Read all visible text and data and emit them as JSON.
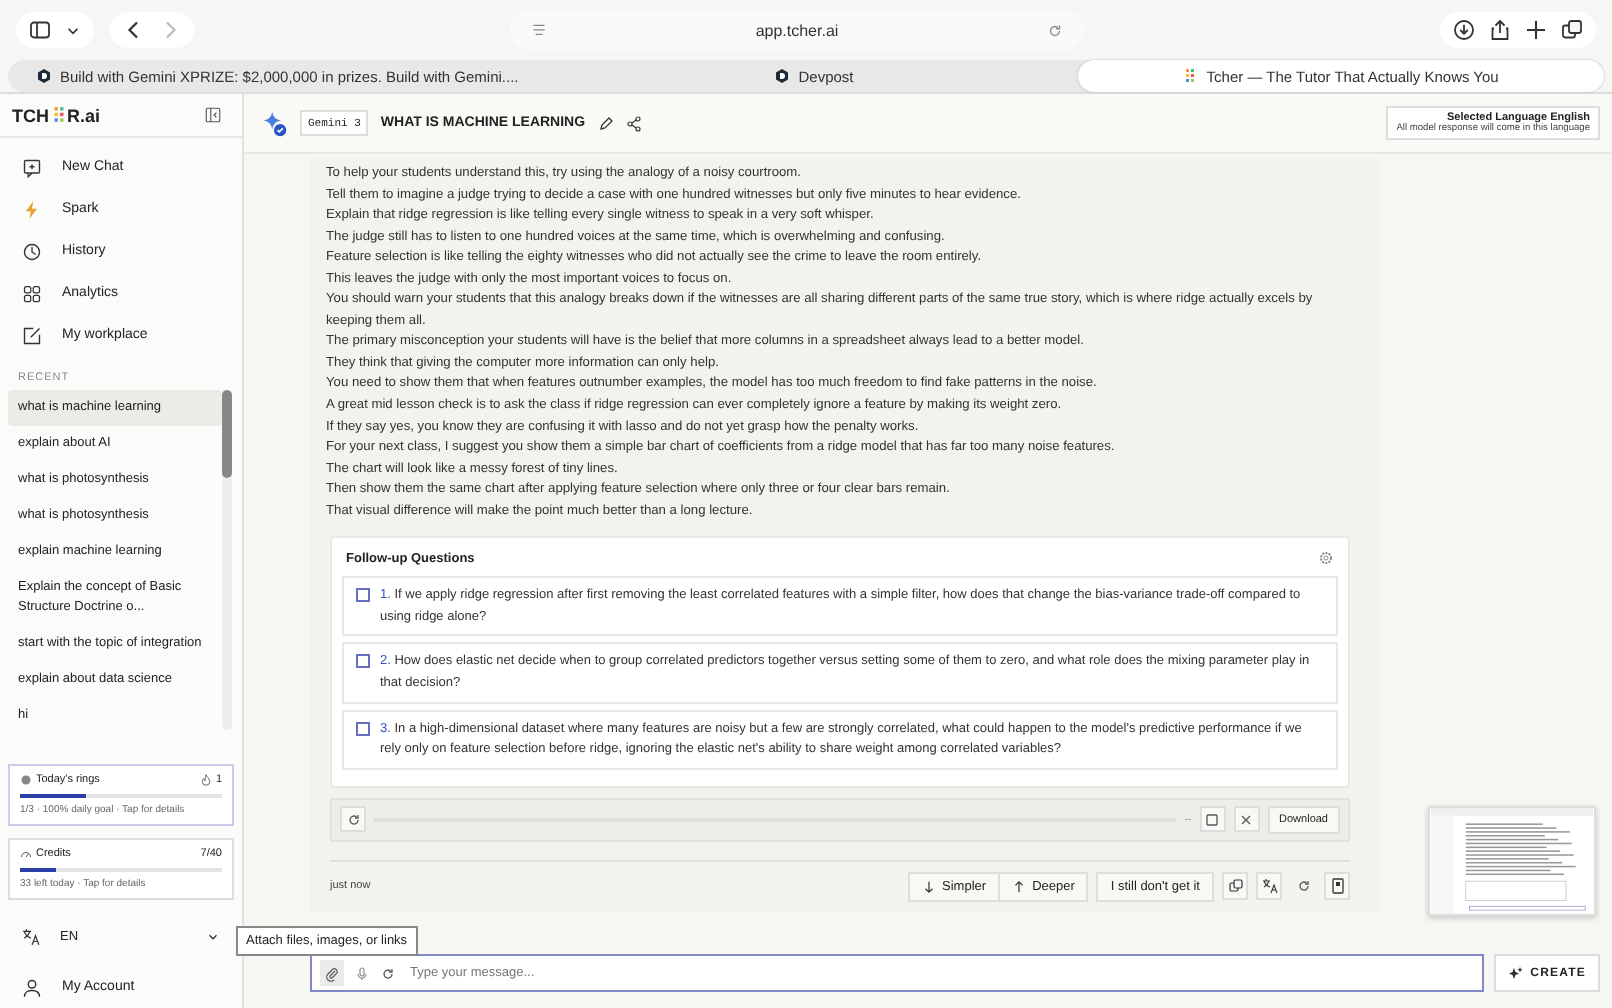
{
  "browser": {
    "url": "app.tcher.ai",
    "tabs": [
      {
        "title": "Build with Gemini XPRIZE: $2,000,000 in prizes. Build with Gemini....",
        "kind": "devpost",
        "selected": false
      },
      {
        "title": "Devpost",
        "kind": "devpost",
        "selected": false
      },
      {
        "title": "Tcher — The Tutor That Actually Knows You",
        "kind": "dots",
        "selected": true
      }
    ]
  },
  "sidebar": {
    "logo_left": "TCH",
    "logo_right": "R.ai",
    "nav": [
      {
        "label": "New Chat",
        "kind": "chat"
      },
      {
        "label": "Spark",
        "kind": "bolt"
      },
      {
        "label": "History",
        "kind": "clock"
      },
      {
        "label": "Analytics",
        "kind": "grid"
      },
      {
        "label": "My workplace",
        "kind": "edit"
      }
    ],
    "recent_heading": "RECENT",
    "recent": [
      {
        "label": "what is machine learning",
        "selected": true
      },
      {
        "label": "explain about AI",
        "selected": false
      },
      {
        "label": "what is photosynthesis",
        "selected": false
      },
      {
        "label": "what is photosynthesis",
        "selected": false
      },
      {
        "label": "explain machine learning",
        "selected": false
      },
      {
        "label": "Explain the concept of Basic Structure Doctrine o...",
        "selected": false
      },
      {
        "label": "start with the topic of integration",
        "selected": false
      },
      {
        "label": "explain about data science",
        "selected": false
      },
      {
        "label": "hi",
        "selected": false
      }
    ],
    "rings": {
      "title": "Today's rings",
      "count": "1",
      "level": 0.33,
      "note": "1/3 · 100% daily goal · Tap for details"
    },
    "credits": {
      "title": "Credits",
      "count": "7/40",
      "level": 0.18,
      "note": "33 left today · Tap for details"
    },
    "language": "EN",
    "account": "My Account"
  },
  "header": {
    "model": "Gemini 3",
    "title": "WHAT IS MACHINE LEARNING",
    "language_title": "Selected Language English",
    "language_note": "All model response will come in this language"
  },
  "message": {
    "lines": [
      "To help your students understand this, try using the analogy of a noisy courtroom.",
      "Tell them to imagine a judge trying to decide a case with one hundred witnesses but only five minutes to hear evidence.",
      "Explain that ridge regression is like telling every single witness to speak in a very soft whisper.",
      "The judge still has to listen to one hundred voices at the same time, which is overwhelming and confusing.",
      "Feature selection is like telling the eighty witnesses who did not actually see the crime to leave the room entirely.",
      "This leaves the judge with only the most important voices to focus on.",
      "You should warn your students that this analogy breaks down if the witnesses are all sharing different parts of the same true story, which is where ridge actually excels by keeping them all.",
      "The primary misconception your students will have is the belief that more columns in a spreadsheet always lead to a better model.",
      "They think that giving the computer more information can only help.",
      "You need to show them that when features outnumber examples, the model has too much freedom to find fake patterns in the noise.",
      "A great mid lesson check is to ask the class if ridge regression can ever completely ignore a feature by making its weight zero.",
      "If they say yes, you know they are confusing it with lasso and do not yet grasp how the penalty works.",
      "For your next class, I suggest you show them a simple bar chart of coefficients from a ridge model that has far too many noise features.",
      "The chart will look like a messy forest of tiny lines.",
      "Then show them the same chart after applying feature selection where only three or four clear bars remain.",
      "That visual difference will make the point much better than a long lecture."
    ],
    "followups": {
      "title": "Follow-up Questions",
      "items": [
        {
          "number": "1.",
          "text": "If we apply ridge regression after first removing the least correlated features with a simple filter, how does that change the bias-variance trade-off compared to using ridge alone?",
          "checked": false
        },
        {
          "number": "2.",
          "text": "How does elastic net decide when to group correlated predictors together versus setting some of them to zero, and what role does the mixing parameter play in that decision?",
          "checked": false
        },
        {
          "number": "3.",
          "text": "In a high-dimensional dataset where many features are noisy but a few are strongly correlated, what could happen to the model's predictive performance if we rely only on feature selection before ridge, ignoring the elastic net's ability to share weight among correlated variables?",
          "checked": false
        }
      ]
    },
    "player": {
      "time": "--",
      "download": "Download"
    },
    "time": "just now",
    "simpler": "Simpler",
    "deeper": "Deeper",
    "confused": "I still don't get it"
  },
  "composer": {
    "tooltip": "Attach files, images, or links",
    "placeholder": "Type your message...",
    "create": "CREATE"
  }
}
